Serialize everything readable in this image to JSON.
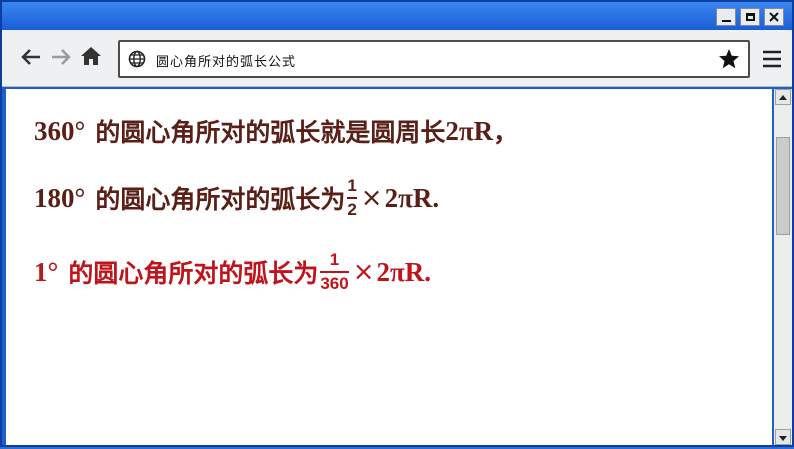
{
  "address_bar": {
    "url": "圆心角所对的弧长公式"
  },
  "icons": {
    "back": "back-arrow-icon",
    "forward": "forward-arrow-icon",
    "home": "home-icon",
    "globe": "globe-icon",
    "bookmark": "star-icon",
    "menu": "hamburger-menu-icon",
    "minimize": "minimize-icon",
    "maximize": "maximize-icon",
    "close": "close-icon"
  },
  "content": {
    "line1": {
      "angle": "360°",
      "text": "的圆心角所对的弧长就是圆周长",
      "formula": "2πR",
      "end": "，"
    },
    "line2": {
      "angle": "180°",
      "text": "的圆心角所对的弧长为",
      "numerator": "1",
      "denominator": "2",
      "times": "×",
      "formula": "2πR."
    },
    "line3": {
      "angle": "1°",
      "text": "的圆心角所对的弧长为",
      "numerator": "1",
      "denominator": "360",
      "times": "×",
      "formula": "2πR."
    }
  },
  "colors": {
    "text_dark": "#5a1f17",
    "text_red": "#c0141b",
    "titlebar": "#1f5fc9"
  }
}
